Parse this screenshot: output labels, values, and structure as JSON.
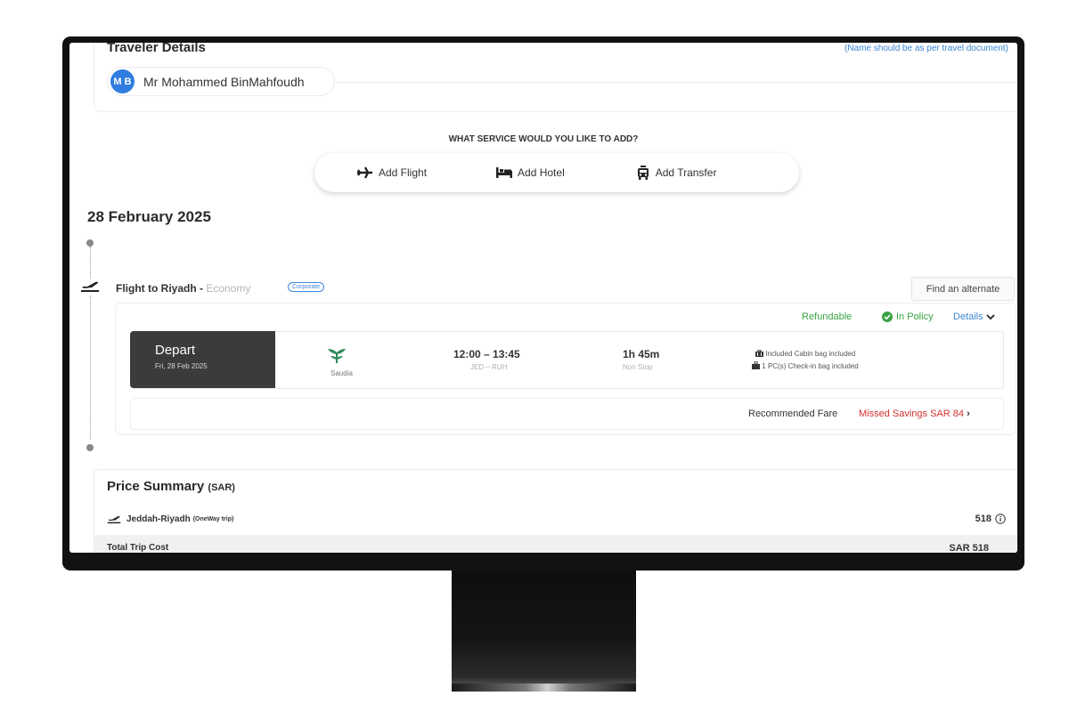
{
  "traveler": {
    "title": "Traveler Details",
    "hint": "(Name should be as per travel document)",
    "initials": "M B",
    "name": "Mr Mohammed BinMahfoudh"
  },
  "services": {
    "title": "WHAT SERVICE WOULD YOU LIKE TO ADD?",
    "add_flight": "Add Flight",
    "add_hotel": "Add Hotel",
    "add_transfer": "Add Transfer"
  },
  "trip_date": "28 February 2025",
  "flight": {
    "title": "Flight to Riyadh - ",
    "cabin_class": "Economy",
    "badge": "Corporate",
    "alternate_label": "Find an alternate",
    "refundable": "Refundable",
    "policy": "In Policy",
    "details_label": "Details",
    "depart_label": "Depart",
    "depart_date": "Fri, 28 Feb 2025",
    "airline": "Saudia",
    "times": "12:00 – 13:45",
    "route": "JED – RUH",
    "duration": "1h 45m",
    "stops": "Non Stop",
    "cabin_bag": "Included Cabin bag included",
    "checkin_bag": "1 PC(s) Check-in bag included",
    "recommended_fare": "Recommended Fare",
    "missed_savings": "Missed Savings SAR 84"
  },
  "price_summary": {
    "title": "Price Summary",
    "currency": "(SAR)",
    "trip_label": "Jeddah-Riyadh",
    "trip_type": "(OneWay trip)",
    "trip_amount": "518",
    "total_label": "Total Trip Cost",
    "total_amount": "SAR 518"
  },
  "colors": {
    "accent_blue": "#3d87d6",
    "success_green": "#39a345",
    "alert_red": "#d0302f",
    "saudia_green": "#2e8b57"
  }
}
